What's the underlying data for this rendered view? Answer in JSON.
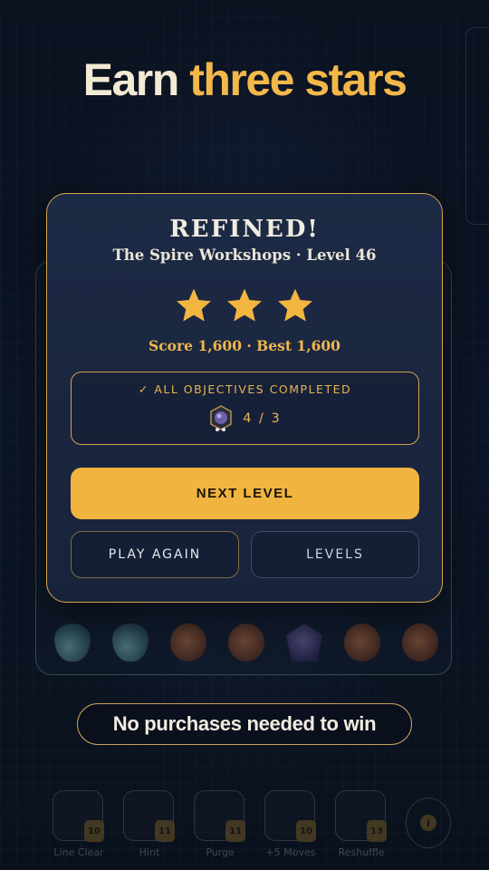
{
  "headline": {
    "part1": "Earn",
    "part2": "three stars"
  },
  "result": {
    "title": "REFINED!",
    "subtitle": "The Spire Workshops · Level 46",
    "stars_earned": 3,
    "stars_total": 3,
    "score_line": "Score 1,600 · Best 1,600",
    "objectives_label": "✓ ALL OBJECTIVES COMPLETED",
    "objective_icon": "amethyst-gem-icon",
    "objective_count": "4 / 3",
    "next_label": "NEXT LEVEL",
    "play_again_label": "PLAY AGAIN",
    "levels_label": "LEVELS"
  },
  "banner": {
    "text": "No purchases needed to win"
  },
  "boosters": [
    {
      "label": "Line Clear",
      "count": "10"
    },
    {
      "label": "Hint",
      "count": "11"
    },
    {
      "label": "Purge",
      "count": "11"
    },
    {
      "label": "+5 Moves",
      "count": "10"
    },
    {
      "label": "Reshuffle",
      "count": "13"
    }
  ],
  "colors": {
    "accent": "#f1b441",
    "background": "#0b1220",
    "panel": "#1d2a45"
  }
}
